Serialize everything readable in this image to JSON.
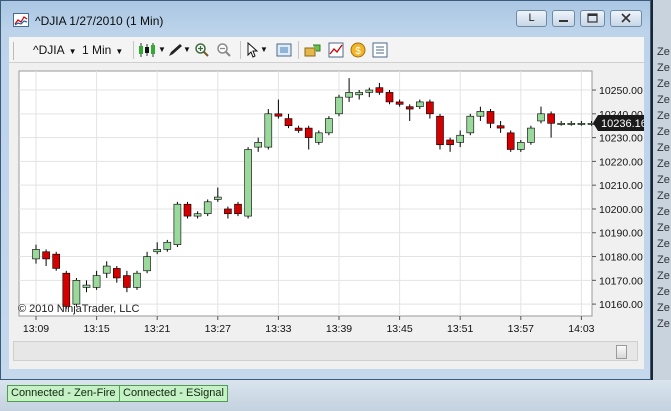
{
  "window": {
    "title": "^DJIA  1/27/2010 (1 Min)",
    "layout_button": "L"
  },
  "toolbar": {
    "instrument": "^DJIA",
    "interval": "1 Min"
  },
  "chart": {
    "copyright": "© 2010 NinjaTrader, LLC",
    "last_price": "10236.16",
    "colors": {
      "up": "#9bd89b",
      "down": "#d40000",
      "last_box": "#1a1a1a"
    }
  },
  "status": {
    "connections": [
      "Connected - Zen-Fire",
      "Connected - ESignal"
    ]
  },
  "background": {
    "partial_labels": [
      "Ze",
      "Ze",
      "Ze",
      "Ze",
      "Ze",
      "Ze",
      "Ze",
      "Ze",
      "Ze",
      "Ze",
      "Ze",
      "Ze",
      "Ze",
      "Ze",
      "Ze",
      "Ze",
      "Ze",
      "Ze"
    ]
  },
  "chart_data": {
    "type": "candlestick",
    "title": "^DJIA  1/27/2010 (1 Min)",
    "x_tick_labels": [
      "13:09",
      "13:15",
      "13:21",
      "13:27",
      "13:33",
      "13:39",
      "13:45",
      "13:51",
      "13:57",
      "14:03"
    ],
    "y_tick_labels": [
      "10250.00",
      "10240.00",
      "10230.00",
      "10220.00",
      "10210.00",
      "10200.00",
      "10190.00",
      "10180.00",
      "10170.00",
      "10160.00"
    ],
    "ylim": [
      10155,
      10258
    ],
    "grid": true,
    "last_price": 10236.16,
    "candles": [
      {
        "t": "13:09",
        "o": 10179,
        "h": 10185,
        "l": 10177,
        "c": 10183
      },
      {
        "t": "13:10",
        "o": 10182,
        "h": 10183,
        "l": 10176,
        "c": 10179
      },
      {
        "t": "13:11",
        "o": 10181,
        "h": 10182,
        "l": 10174,
        "c": 10175
      },
      {
        "t": "13:12",
        "o": 10173,
        "h": 10174,
        "l": 10158,
        "c": 10159
      },
      {
        "t": "13:13",
        "o": 10160,
        "h": 10171,
        "l": 10159,
        "c": 10170
      },
      {
        "t": "13:14",
        "o": 10167,
        "h": 10170,
        "l": 10165,
        "c": 10168
      },
      {
        "t": "13:15",
        "o": 10167,
        "h": 10174,
        "l": 10166,
        "c": 10172
      },
      {
        "t": "13:16",
        "o": 10173,
        "h": 10178,
        "l": 10171,
        "c": 10176
      },
      {
        "t": "13:17",
        "o": 10175,
        "h": 10176,
        "l": 10169,
        "c": 10171
      },
      {
        "t": "13:18",
        "o": 10172,
        "h": 10174,
        "l": 10165,
        "c": 10167
      },
      {
        "t": "13:19",
        "o": 10167,
        "h": 10174,
        "l": 10166,
        "c": 10173
      },
      {
        "t": "13:20",
        "o": 10174,
        "h": 10182,
        "l": 10173,
        "c": 10180
      },
      {
        "t": "13:21",
        "o": 10182,
        "h": 10186,
        "l": 10181,
        "c": 10183
      },
      {
        "t": "13:22",
        "o": 10183,
        "h": 10187,
        "l": 10182,
        "c": 10186
      },
      {
        "t": "13:23",
        "o": 10185,
        "h": 10203,
        "l": 10184,
        "c": 10202
      },
      {
        "t": "13:24",
        "o": 10202,
        "h": 10203,
        "l": 10196,
        "c": 10197
      },
      {
        "t": "13:25",
        "o": 10197,
        "h": 10199,
        "l": 10196,
        "c": 10198
      },
      {
        "t": "13:26",
        "o": 10198,
        "h": 10204,
        "l": 10197,
        "c": 10203
      },
      {
        "t": "13:27",
        "o": 10204,
        "h": 10209,
        "l": 10203,
        "c": 10205
      },
      {
        "t": "13:28",
        "o": 10200,
        "h": 10201,
        "l": 10196,
        "c": 10198
      },
      {
        "t": "13:29",
        "o": 10202,
        "h": 10203,
        "l": 10197,
        "c": 10198
      },
      {
        "t": "13:30",
        "o": 10197,
        "h": 10226,
        "l": 10196,
        "c": 10225
      },
      {
        "t": "13:31",
        "o": 10226,
        "h": 10230,
        "l": 10224,
        "c": 10228
      },
      {
        "t": "13:32",
        "o": 10226,
        "h": 10242,
        "l": 10225,
        "c": 10240
      },
      {
        "t": "13:33",
        "o": 10240,
        "h": 10246,
        "l": 10238,
        "c": 10239
      },
      {
        "t": "13:34",
        "o": 10238,
        "h": 10240,
        "l": 10234,
        "c": 10235
      },
      {
        "t": "13:35",
        "o": 10234,
        "h": 10235,
        "l": 10232,
        "c": 10233
      },
      {
        "t": "13:36",
        "o": 10234,
        "h": 10235,
        "l": 10225,
        "c": 10230
      },
      {
        "t": "13:37",
        "o": 10228,
        "h": 10233,
        "l": 10227,
        "c": 10232
      },
      {
        "t": "13:38",
        "o": 10232,
        "h": 10239,
        "l": 10231,
        "c": 10238
      },
      {
        "t": "13:39",
        "o": 10240,
        "h": 10248,
        "l": 10239,
        "c": 10247
      },
      {
        "t": "13:40",
        "o": 10247,
        "h": 10255,
        "l": 10245,
        "c": 10249
      },
      {
        "t": "13:41",
        "o": 10248,
        "h": 10250,
        "l": 10246,
        "c": 10249
      },
      {
        "t": "13:42",
        "o": 10249,
        "h": 10251,
        "l": 10247,
        "c": 10250
      },
      {
        "t": "13:43",
        "o": 10251,
        "h": 10253,
        "l": 10248,
        "c": 10249
      },
      {
        "t": "13:44",
        "o": 10249,
        "h": 10250,
        "l": 10244,
        "c": 10245
      },
      {
        "t": "13:45",
        "o": 10245,
        "h": 10246,
        "l": 10243,
        "c": 10244
      },
      {
        "t": "13:46",
        "o": 10243,
        "h": 10244,
        "l": 10237,
        "c": 10242
      },
      {
        "t": "13:47",
        "o": 10243,
        "h": 10246,
        "l": 10242,
        "c": 10245
      },
      {
        "t": "13:48",
        "o": 10245,
        "h": 10246,
        "l": 10238,
        "c": 10240
      },
      {
        "t": "13:49",
        "o": 10239,
        "h": 10240,
        "l": 10225,
        "c": 10227
      },
      {
        "t": "13:50",
        "o": 10229,
        "h": 10230,
        "l": 10224,
        "c": 10227
      },
      {
        "t": "13:51",
        "o": 10228,
        "h": 10233,
        "l": 10226,
        "c": 10231
      },
      {
        "t": "13:52",
        "o": 10232,
        "h": 10240,
        "l": 10231,
        "c": 10239
      },
      {
        "t": "13:53",
        "o": 10239,
        "h": 10243,
        "l": 10237,
        "c": 10241
      },
      {
        "t": "13:54",
        "o": 10241,
        "h": 10242,
        "l": 10234,
        "c": 10236
      },
      {
        "t": "13:55",
        "o": 10235,
        "h": 10237,
        "l": 10232,
        "c": 10234
      },
      {
        "t": "13:56",
        "o": 10232,
        "h": 10233,
        "l": 10224,
        "c": 10225
      },
      {
        "t": "13:57",
        "o": 10225,
        "h": 10229,
        "l": 10224,
        "c": 10228
      },
      {
        "t": "13:58",
        "o": 10228,
        "h": 10235,
        "l": 10227,
        "c": 10234
      },
      {
        "t": "13:59",
        "o": 10237,
        "h": 10243,
        "l": 10236,
        "c": 10240
      },
      {
        "t": "14:00",
        "o": 10240,
        "h": 10241,
        "l": 10230,
        "c": 10236
      },
      {
        "t": "14:01",
        "o": 10236,
        "h": 10237,
        "l": 10235,
        "c": 10236
      },
      {
        "t": "14:02",
        "o": 10236,
        "h": 10237,
        "l": 10235,
        "c": 10236
      },
      {
        "t": "14:03",
        "o": 10236,
        "h": 10237,
        "l": 10235,
        "c": 10236
      },
      {
        "t": "14:04",
        "o": 10236,
        "h": 10237,
        "l": 10235,
        "c": 10236
      }
    ]
  }
}
